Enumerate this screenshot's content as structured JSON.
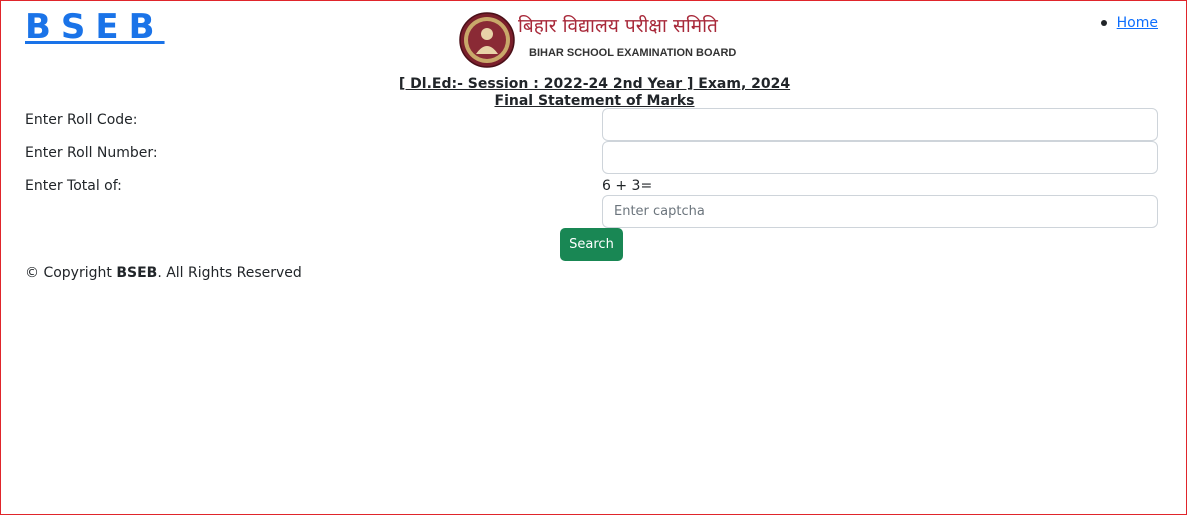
{
  "header": {
    "brand": "BSEB",
    "logo_hindi": "बिहार विद्यालय परीक्षा समिति",
    "logo_english": "BIHAR SCHOOL EXAMINATION BOARD",
    "nav": [
      {
        "label": "Home"
      }
    ]
  },
  "title": {
    "exam": "[ Dl.Ed:- Session : 2022-24 2nd Year ] Exam, 2024",
    "statement": "Final Statement of Marks"
  },
  "form": {
    "roll_code_label": "Enter Roll Code:",
    "roll_code_value": "",
    "roll_number_label": "Enter Roll Number:",
    "roll_number_value": "",
    "total_label": "Enter Total of:",
    "captcha_question": "6 + 3=",
    "captcha_placeholder": "Enter captcha",
    "captcha_value": "",
    "search_label": "Search"
  },
  "footer": {
    "copyright_prefix": "© Copyright ",
    "copyright_org": "BSEB",
    "copyright_suffix": ". All Rights Reserved"
  },
  "colors": {
    "brand": "#1a73e8",
    "link": "#0d6efd",
    "button": "#198754",
    "frame_border": "#e0252b",
    "logo_hindi": "#a8293a"
  }
}
